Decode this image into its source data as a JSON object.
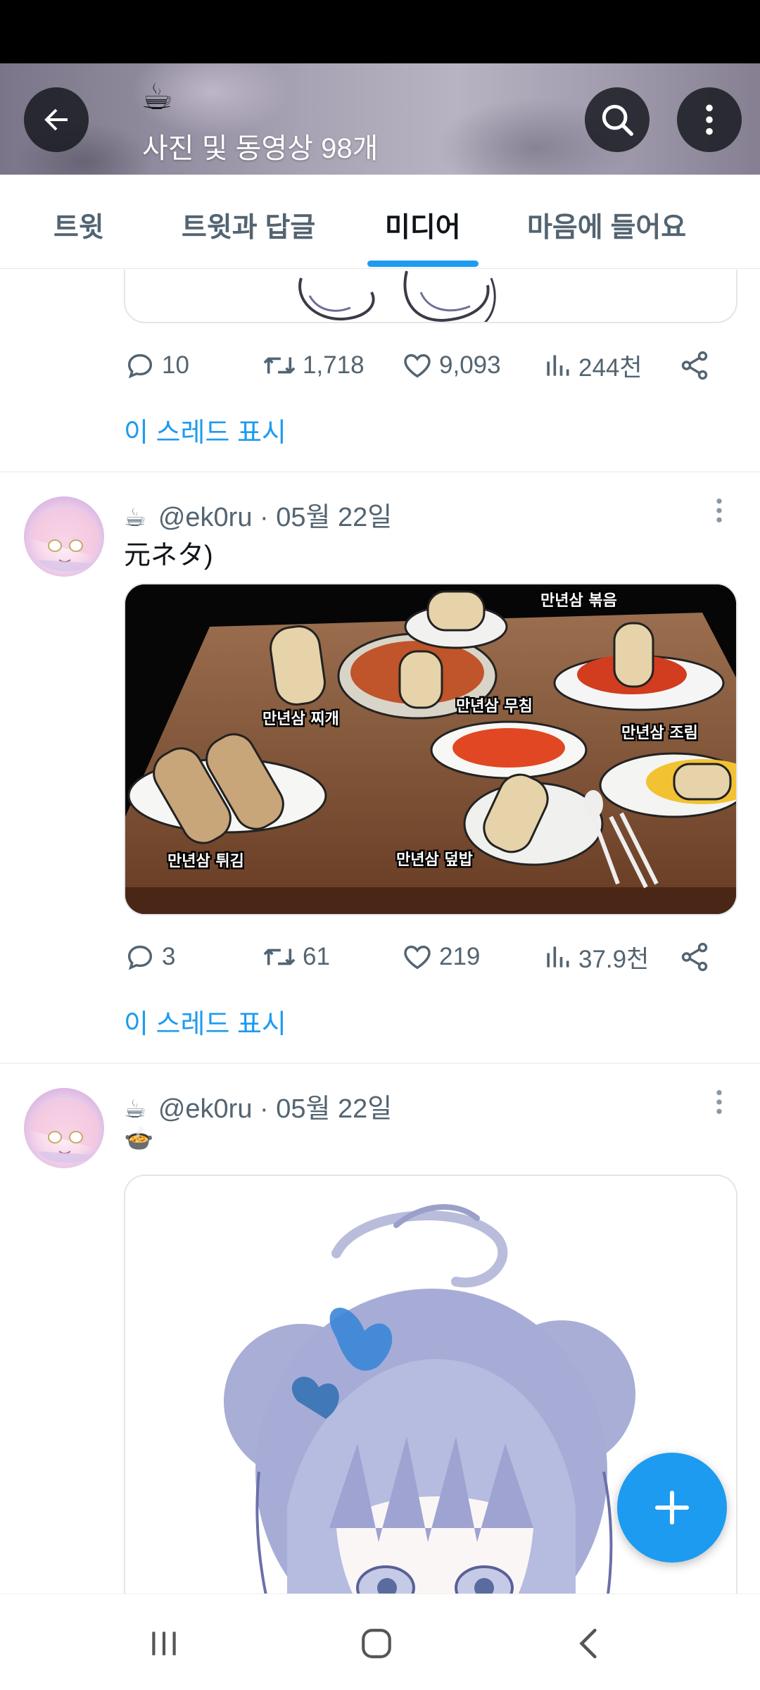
{
  "header": {
    "emoji": "☕",
    "title": "사진 및 동영상 98개"
  },
  "tabs": [
    {
      "label": "트윗",
      "active": false
    },
    {
      "label": "트윗과 답글",
      "active": false
    },
    {
      "label": "미디어",
      "active": true
    },
    {
      "label": "마음에 들어요",
      "active": false
    }
  ],
  "tweets": [
    {
      "actions": {
        "replies": "10",
        "retweets": "1,718",
        "likes": "9,093",
        "views": "244천"
      },
      "show_thread": "이 스레드 표시"
    },
    {
      "emoji": "☕",
      "handle": "@ek0ru",
      "date": "· 05월 22일",
      "text": "元ネタ)",
      "image_labels": [
        "만년삼 볶음",
        "만년삼 찌개",
        "만년삼 무침",
        "만년삼 조림",
        "만년삼 튀김",
        "만년삼 덮밥"
      ],
      "actions": {
        "replies": "3",
        "retweets": "61",
        "likes": "219",
        "views": "37.9천"
      },
      "show_thread": "이 스레드 표시"
    },
    {
      "emoji": "☕",
      "handle": "@ek0ru",
      "date": "· 05월 22일",
      "text": "🍲"
    }
  ],
  "colors": {
    "accent": "#1d9bf0",
    "text": "#0f1419",
    "muted": "#536471"
  }
}
